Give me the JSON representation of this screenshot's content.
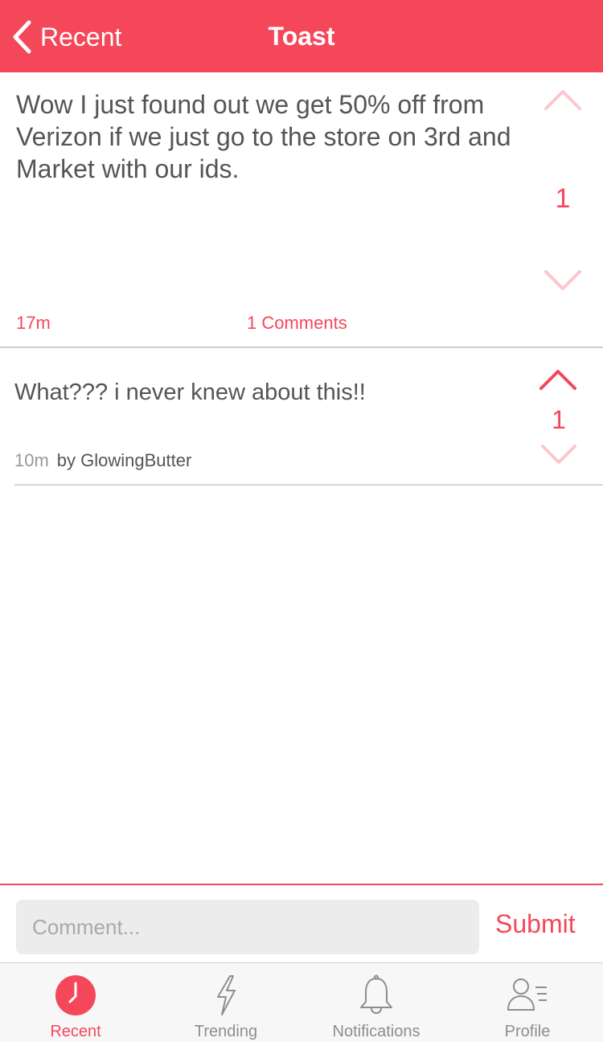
{
  "nav": {
    "back_label": "Recent",
    "title": "Toast"
  },
  "post": {
    "text": "Wow I just found out we get 50% off from Verizon if we just go to the store on 3rd and Market with our ids.",
    "score": "1",
    "time": "17m",
    "comments_label": "1 Comments"
  },
  "comments": [
    {
      "text": "What??? i never knew about this!!",
      "score": "1",
      "time": "10m",
      "author": "by GlowingButter"
    }
  ],
  "compose": {
    "placeholder": "Comment...",
    "value": "",
    "submit_label": "Submit"
  },
  "tabs": [
    {
      "label": "Recent",
      "icon": "clock-icon",
      "active": true
    },
    {
      "label": "Trending",
      "icon": "lightning-icon",
      "active": false
    },
    {
      "label": "Notifications",
      "icon": "bell-icon",
      "active": false
    },
    {
      "label": "Profile",
      "icon": "profile-icon",
      "active": false
    }
  ],
  "colors": {
    "accent": "#f5475a",
    "vote_faded": "#fbc7cd",
    "text": "#555555",
    "tab_inactive": "#8e8e8e"
  }
}
